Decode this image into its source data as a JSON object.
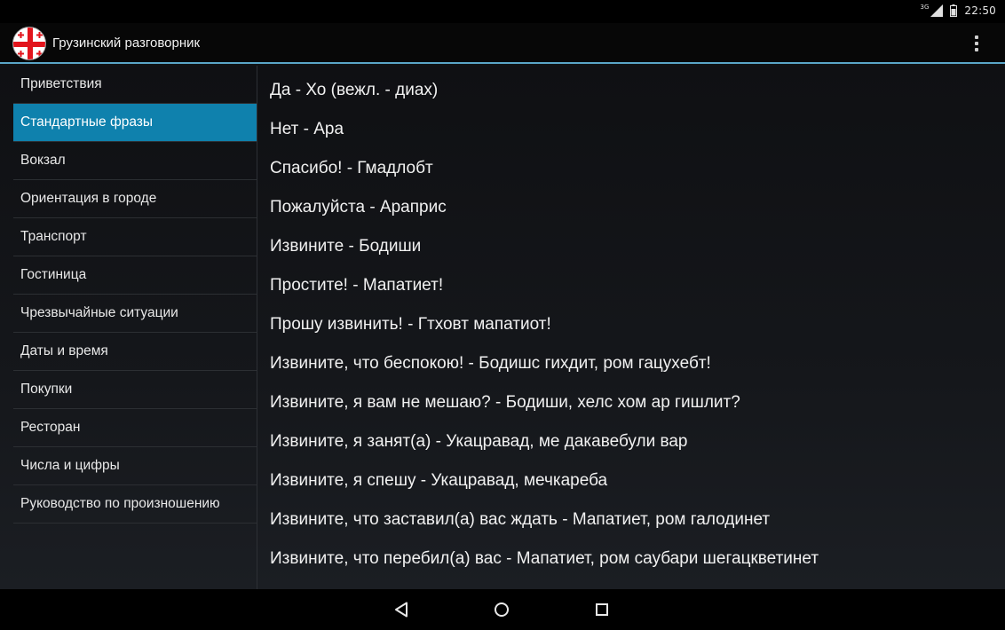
{
  "status_bar": {
    "network_type": "3G",
    "time": "22:50",
    "icons": [
      "signal-icon",
      "battery-icon"
    ]
  },
  "action_bar": {
    "title": "Грузинский разговорник",
    "app_icon": "georgian-flag-icon",
    "overflow_icon": "overflow-menu-icon"
  },
  "sidebar": {
    "selected_index": 1,
    "items": [
      {
        "label": "Приветствия"
      },
      {
        "label": "Стандартные фразы"
      },
      {
        "label": "Вокзал"
      },
      {
        "label": "Ориентация в городе"
      },
      {
        "label": "Транспорт"
      },
      {
        "label": "Гостиница"
      },
      {
        "label": "Чрезвычайные ситуации"
      },
      {
        "label": "Даты и время"
      },
      {
        "label": "Покупки"
      },
      {
        "label": "Ресторан"
      },
      {
        "label": "Числа и цифры"
      },
      {
        "label": "Руководство по произношению"
      }
    ]
  },
  "phrases": [
    "Да - Хо (вежл. - диах)",
    "Нет - Ара",
    "Спасибо! - Гмадлобт",
    "Пожалуйста - Араприс",
    "Извините - Бодиши",
    "Простите! - Мапатиет!",
    "Прошу извинить! - Гтховт мапатиот!",
    "Извините, что беспокою! - Бодишс гихдит, ром гацухебт!",
    "Извините, я вам не мешаю? - Бодиши, хелс хом ар гишлит?",
    "Извините, я занят(а) - Укацравад, ме дакавебули вар",
    "Извините, я спешу - Укацравад, мечкареба",
    "Извините, что заставил(а) вас ждать - Мапатиет, ром галодинет",
    "Извините, что перебил(а) вас - Мапатиет, ром саубари шегацкветинет"
  ],
  "nav_bar": {
    "icons": [
      "back-icon",
      "home-icon",
      "recents-icon"
    ]
  },
  "colors": {
    "accent": "#0f81ad",
    "action_bar_underline": "#5aa6c8",
    "text": "#f1f1f1",
    "flag_red": "#e2141c"
  }
}
